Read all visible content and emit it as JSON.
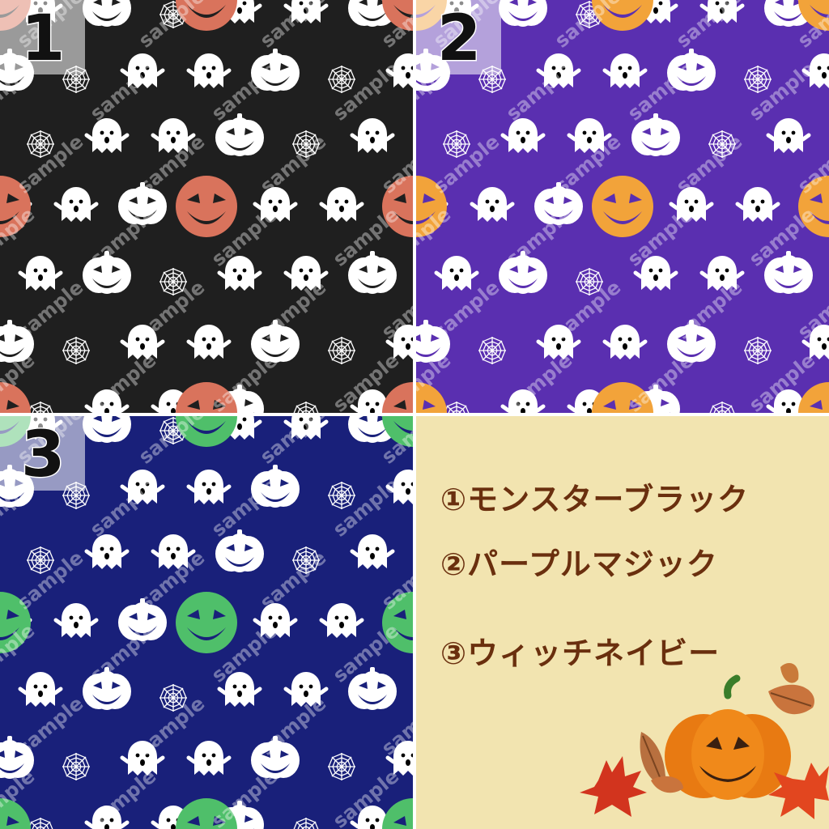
{
  "panels": [
    {
      "number": "1",
      "background": "#1f1f1f",
      "accent_pumpkin": "#d9735c"
    },
    {
      "number": "2",
      "background": "#5a2fb0",
      "accent_pumpkin": "#f2a33a"
    },
    {
      "number": "3",
      "background": "#19207a",
      "accent_pumpkin": "#4fbf6a"
    }
  ],
  "watermark": "sample",
  "legend": {
    "background": "#f2e4b0",
    "items": [
      "①モンスターブラック",
      "②パープルマジック",
      "③ウィッチネイビー"
    ],
    "text_color": "#6a2f0e"
  },
  "icons": [
    "ghost-icon",
    "pumpkin-icon",
    "spiderweb-icon",
    "maple-leaf-icon",
    "jack-o-lantern-icon"
  ]
}
